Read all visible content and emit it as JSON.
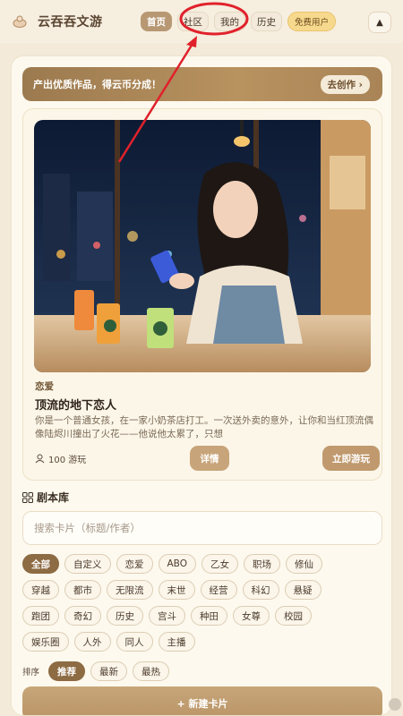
{
  "header": {
    "app_title": "云吞吞文游",
    "nav": [
      {
        "label": "首页",
        "active": true
      },
      {
        "label": "社区",
        "active": false
      },
      {
        "label": "我的",
        "active": false
      },
      {
        "label": "历史",
        "active": false
      }
    ],
    "badge": "免费用户",
    "up_icon": "▲"
  },
  "promo": {
    "text": "产出优质作品，得云币分成！",
    "button": "去创作 ›"
  },
  "story": {
    "category": "恋爱",
    "title": "顶流的地下恋人",
    "description": "你是一个普通女孩，在一家小奶茶店打工。一次送外卖的意外，让你和当红顶流偶像陆烬川撞出了火花——他说他太累了，只想",
    "plays": "100 游玩",
    "detail_button": "详情",
    "play_button": "立即游玩"
  },
  "library": {
    "heading": "剧本库",
    "search_placeholder": "搜索卡片（标题/作者）",
    "tag_rows": [
      [
        "全部",
        "自定义",
        "恋爱",
        "ABO",
        "乙女",
        "职场",
        "修仙"
      ],
      [
        "穿越",
        "都市",
        "无限流",
        "末世",
        "经营",
        "科幻",
        "悬疑"
      ],
      [
        "跑团",
        "奇幻",
        "历史",
        "宫斗",
        "种田",
        "女尊",
        "校园"
      ],
      [
        "娱乐圈",
        "人外",
        "同人",
        "主播"
      ]
    ],
    "active_tag": "全部",
    "sort_label": "排序",
    "sort_options": [
      "推荐",
      "最新",
      "最热"
    ],
    "active_sort": "推荐",
    "new_card_button": "+ 新建卡片"
  },
  "colors": {
    "accent": "#8d6b43",
    "annotation": "#e0212b",
    "background": "#f3ead9"
  }
}
